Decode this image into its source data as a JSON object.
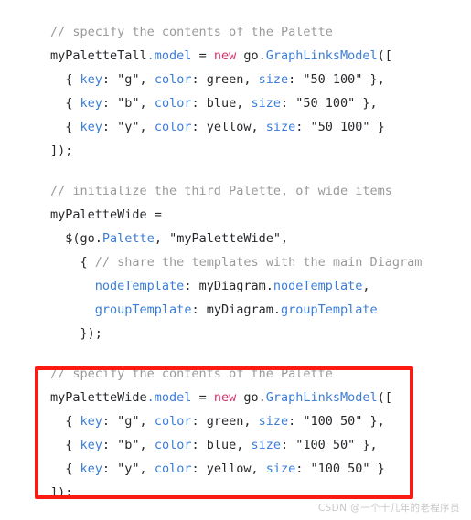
{
  "page": {
    "background_color": "#ffffff",
    "watermark": "CSDN @一个十几年的老程序员"
  },
  "syntax_colors": {
    "comment": "#9a9a9a",
    "plain": "#26282b",
    "property": "#3b7dd8",
    "type": "#3b7dd8",
    "keyword": "#d6336c",
    "highlight_border": "#fc1b12"
  },
  "code": {
    "block_tall": {
      "lines": [
        {
          "indent": "",
          "tokens": [
            {
              "t": "comment",
              "v": "// specify the contents of the Palette"
            }
          ]
        },
        {
          "indent": "",
          "tokens": [
            {
              "t": "plain",
              "v": "myPaletteTall"
            },
            {
              "t": "property",
              "v": ".model"
            },
            {
              "t": "plain",
              "v": " = "
            },
            {
              "t": "keyword",
              "v": "new"
            },
            {
              "t": "plain",
              "v": " go."
            },
            {
              "t": "type",
              "v": "GraphLinksModel"
            },
            {
              "t": "plain",
              "v": "(["
            }
          ]
        },
        {
          "indent": "  ",
          "tokens": [
            {
              "t": "plain",
              "v": "{ "
            },
            {
              "t": "property",
              "v": "key"
            },
            {
              "t": "plain",
              "v": ": \"g\", "
            },
            {
              "t": "property",
              "v": "color"
            },
            {
              "t": "plain",
              "v": ": green, "
            },
            {
              "t": "property",
              "v": "size"
            },
            {
              "t": "plain",
              "v": ": \"50 100\" },"
            }
          ]
        },
        {
          "indent": "  ",
          "tokens": [
            {
              "t": "plain",
              "v": "{ "
            },
            {
              "t": "property",
              "v": "key"
            },
            {
              "t": "plain",
              "v": ": \"b\", "
            },
            {
              "t": "property",
              "v": "color"
            },
            {
              "t": "plain",
              "v": ": blue, "
            },
            {
              "t": "property",
              "v": "size"
            },
            {
              "t": "plain",
              "v": ": \"50 100\" },"
            }
          ]
        },
        {
          "indent": "  ",
          "tokens": [
            {
              "t": "plain",
              "v": "{ "
            },
            {
              "t": "property",
              "v": "key"
            },
            {
              "t": "plain",
              "v": ": \"y\", "
            },
            {
              "t": "property",
              "v": "color"
            },
            {
              "t": "plain",
              "v": ": yellow, "
            },
            {
              "t": "property",
              "v": "size"
            },
            {
              "t": "plain",
              "v": ": \"50 100\" }"
            }
          ]
        },
        {
          "indent": "",
          "tokens": [
            {
              "t": "plain",
              "v": "]);"
            }
          ]
        }
      ]
    },
    "block_wide": {
      "lines": [
        {
          "indent": "",
          "tokens": [
            {
              "t": "comment",
              "v": "// initialize the third Palette, of wide items"
            }
          ]
        },
        {
          "indent": "",
          "tokens": [
            {
              "t": "plain",
              "v": "myPaletteWide ="
            }
          ]
        },
        {
          "indent": "  ",
          "tokens": [
            {
              "t": "plain",
              "v": "$(go."
            },
            {
              "t": "type",
              "v": "Palette"
            },
            {
              "t": "plain",
              "v": ", \"myPaletteWide\","
            }
          ]
        },
        {
          "indent": "    ",
          "tokens": [
            {
              "t": "plain",
              "v": "{ "
            },
            {
              "t": "comment",
              "v": "// share the templates with the main Diagram"
            }
          ]
        },
        {
          "indent": "      ",
          "tokens": [
            {
              "t": "property",
              "v": "nodeTemplate"
            },
            {
              "t": "plain",
              "v": ": myDiagram."
            },
            {
              "t": "property",
              "v": "nodeTemplate"
            },
            {
              "t": "plain",
              "v": ","
            }
          ]
        },
        {
          "indent": "      ",
          "tokens": [
            {
              "t": "property",
              "v": "groupTemplate"
            },
            {
              "t": "plain",
              "v": ": myDiagram."
            },
            {
              "t": "property",
              "v": "groupTemplate"
            }
          ]
        },
        {
          "indent": "    ",
          "tokens": [
            {
              "t": "plain",
              "v": "});"
            }
          ]
        }
      ]
    },
    "block_wide_model": {
      "lines": [
        {
          "indent": "",
          "tokens": [
            {
              "t": "comment",
              "v": "// specify the contents of the Palette"
            }
          ]
        },
        {
          "indent": "",
          "tokens": [
            {
              "t": "plain",
              "v": "myPaletteWide"
            },
            {
              "t": "property",
              "v": ".model"
            },
            {
              "t": "plain",
              "v": " = "
            },
            {
              "t": "keyword",
              "v": "new"
            },
            {
              "t": "plain",
              "v": " go."
            },
            {
              "t": "type",
              "v": "GraphLinksModel"
            },
            {
              "t": "plain",
              "v": "(["
            }
          ]
        },
        {
          "indent": "  ",
          "tokens": [
            {
              "t": "plain",
              "v": "{ "
            },
            {
              "t": "property",
              "v": "key"
            },
            {
              "t": "plain",
              "v": ": \"g\", "
            },
            {
              "t": "property",
              "v": "color"
            },
            {
              "t": "plain",
              "v": ": green, "
            },
            {
              "t": "property",
              "v": "size"
            },
            {
              "t": "plain",
              "v": ": \"100 50\" },"
            }
          ]
        },
        {
          "indent": "  ",
          "tokens": [
            {
              "t": "plain",
              "v": "{ "
            },
            {
              "t": "property",
              "v": "key"
            },
            {
              "t": "plain",
              "v": ": \"b\", "
            },
            {
              "t": "property",
              "v": "color"
            },
            {
              "t": "plain",
              "v": ": blue, "
            },
            {
              "t": "property",
              "v": "size"
            },
            {
              "t": "plain",
              "v": ": \"100 50\" },"
            }
          ]
        },
        {
          "indent": "  ",
          "tokens": [
            {
              "t": "plain",
              "v": "{ "
            },
            {
              "t": "property",
              "v": "key"
            },
            {
              "t": "plain",
              "v": ": \"y\", "
            },
            {
              "t": "property",
              "v": "color"
            },
            {
              "t": "plain",
              "v": ": yellow, "
            },
            {
              "t": "property",
              "v": "size"
            },
            {
              "t": "plain",
              "v": ": \"100 50\" }"
            }
          ]
        },
        {
          "indent": "",
          "tokens": [
            {
              "t": "plain",
              "v": "]);"
            }
          ]
        }
      ]
    }
  },
  "annotation": {
    "shape": "rectangle",
    "label": "highlighted-code-region"
  }
}
